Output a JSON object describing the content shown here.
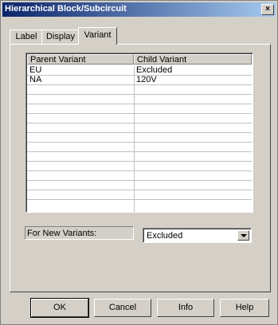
{
  "window": {
    "title": "Hierarchical Block/Subcircuit",
    "close_symbol": "×"
  },
  "tabs": [
    {
      "label": "Label",
      "active": false
    },
    {
      "label": "Display",
      "active": false
    },
    {
      "label": "Variant",
      "active": true
    }
  ],
  "grid": {
    "columns": [
      "Parent Variant",
      "Child Variant"
    ],
    "rows": [
      [
        "EU",
        "Excluded"
      ],
      [
        "NA",
        "120V"
      ],
      [
        "",
        ""
      ],
      [
        "",
        ""
      ],
      [
        "",
        ""
      ],
      [
        "",
        ""
      ],
      [
        "",
        ""
      ],
      [
        "",
        ""
      ],
      [
        "",
        ""
      ],
      [
        "",
        ""
      ],
      [
        "",
        ""
      ],
      [
        "",
        ""
      ],
      [
        "",
        ""
      ],
      [
        "",
        ""
      ]
    ]
  },
  "new_variants": {
    "label": "For New Variants:",
    "value": "Excluded"
  },
  "buttons": {
    "ok": "OK",
    "cancel": "Cancel",
    "info": "Info",
    "help": "Help"
  },
  "icons": {
    "close": "close-icon",
    "dropdown": "chevron-down-icon"
  }
}
